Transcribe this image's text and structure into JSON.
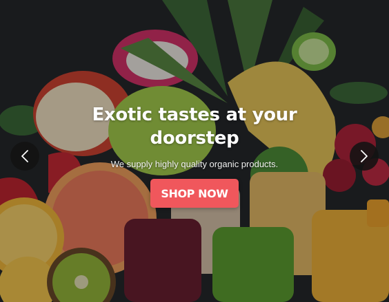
{
  "hero": {
    "title_line1": "Exotic tastes at your",
    "title_line2": "doorstep",
    "subtitle": "We supply highly quality organic products.",
    "cta_label": "SHOP NOW"
  },
  "controls": {
    "prev_icon": "chevron-left-icon",
    "next_icon": "chevron-right-icon"
  },
  "colors": {
    "cta": "#f0575c",
    "arrow_bg": "#121212",
    "text": "#ffffff"
  }
}
